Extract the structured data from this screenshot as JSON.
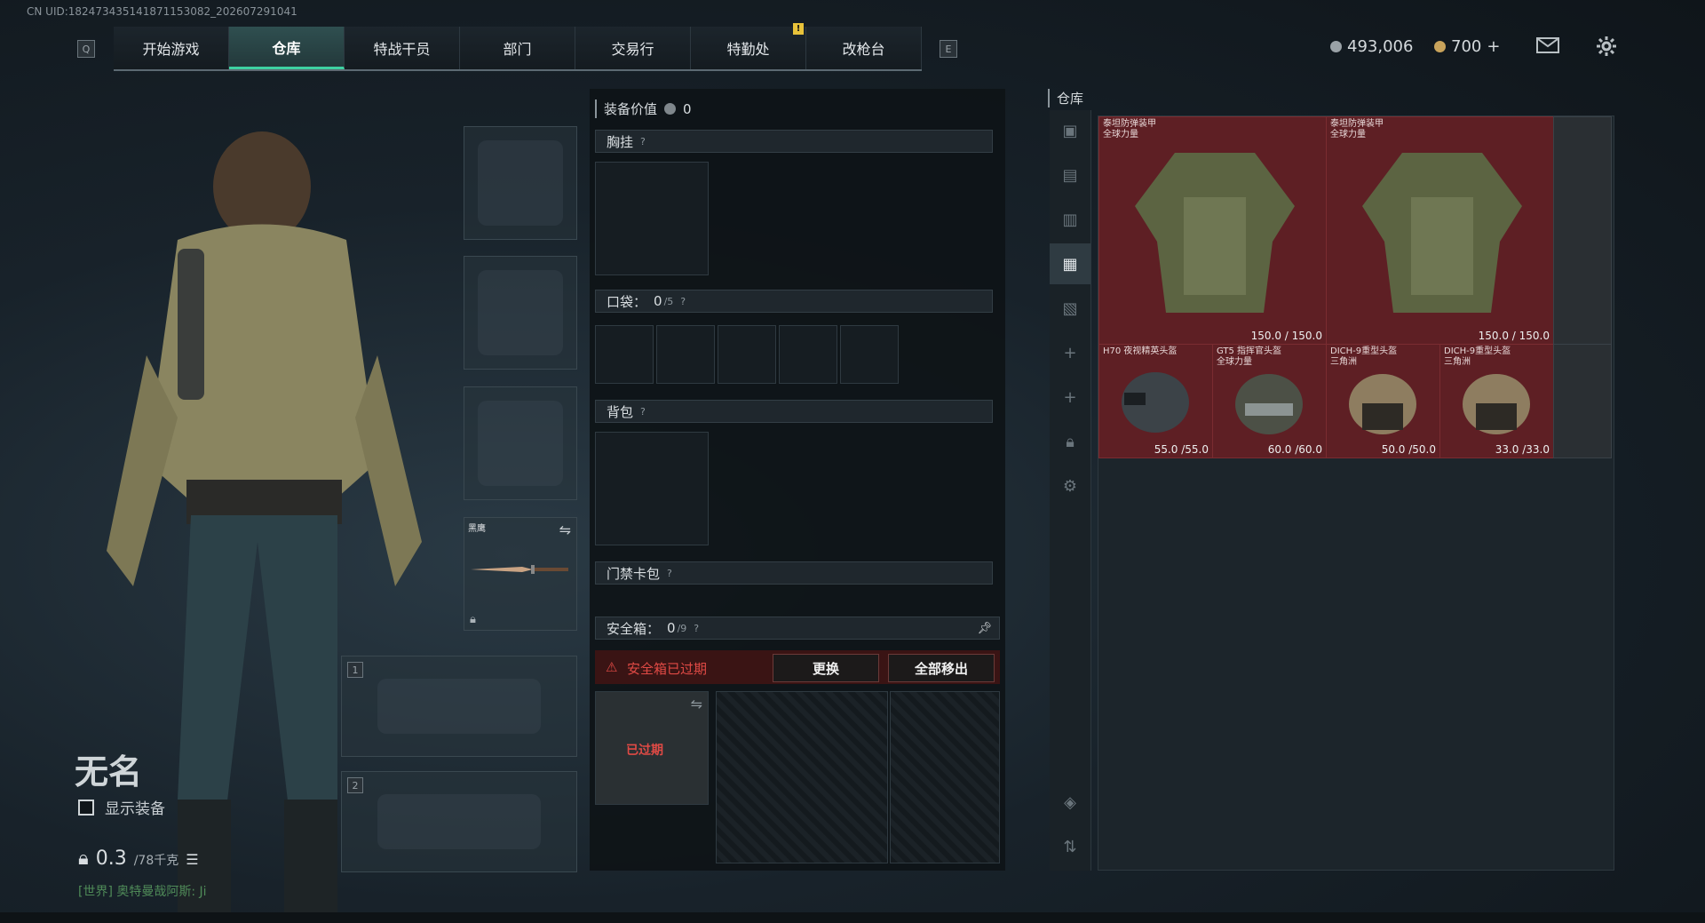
{
  "uid": "CN UID:182473435141871153082_202607291041",
  "nav": {
    "left_key": "Q",
    "right_key": "E",
    "tabs": [
      {
        "label": "开始游戏",
        "active": false
      },
      {
        "label": "仓库",
        "active": true
      },
      {
        "label": "特战干员",
        "active": false
      },
      {
        "label": "部门",
        "active": false
      },
      {
        "label": "交易行",
        "active": false
      },
      {
        "label": "特勤处",
        "active": false
      },
      {
        "label": "改枪台",
        "active": false
      }
    ],
    "alert": "!"
  },
  "currency": {
    "silver": "493,006",
    "gold": "700",
    "gold_add": "+"
  },
  "character": {
    "name": "无名",
    "show_equipment_label": "显示装备",
    "weight_current": "0.3",
    "weight_max": "/78千克",
    "chat_line": "[世界] 奥特曼哉阿斯: Ji"
  },
  "gear": {
    "knife_name": "黑鹰",
    "weapon_slot_1": "1",
    "weapon_slot_2": "2"
  },
  "loadout": {
    "equipment_value_label": "装备价值",
    "equipment_value": "0",
    "chest_rig_label": "胸挂",
    "pockets_label": "口袋：",
    "pockets_count": "0",
    "pockets_max": "/5",
    "backpack_label": "背包",
    "keycard_label": "门禁卡包",
    "safebox_label": "安全箱：",
    "safebox_count": "0",
    "safebox_max": "/9",
    "safebox_expired_msg": "安全箱已过期",
    "replace_label": "更换",
    "remove_all_label": "全部移出",
    "expired_tag": "已过期",
    "qmark": "?"
  },
  "storage": {
    "title": "仓库",
    "items": [
      {
        "name": "泰坦防弹装甲\n全球力量",
        "durability": "150.0 / 150.0"
      },
      {
        "name": "泰坦防弹装甲\n全球力量",
        "durability": "150.0 / 150.0"
      },
      {
        "name": "H70 夜视精英头盔",
        "durability": "55.0 /55.0"
      },
      {
        "name": "GT5 指挥官头盔\n全球力量",
        "durability": "60.0 /60.0"
      },
      {
        "name": "DICH-9重型头盔\n三角洲",
        "durability": "50.0 /50.0"
      },
      {
        "name": "DICH-9重型头盔\n三角洲",
        "durability": "33.0 /33.0"
      }
    ]
  },
  "colors": {
    "accent": "#3ed1a1",
    "item_bg": "#5e1f24",
    "warn": "#e04a45"
  }
}
